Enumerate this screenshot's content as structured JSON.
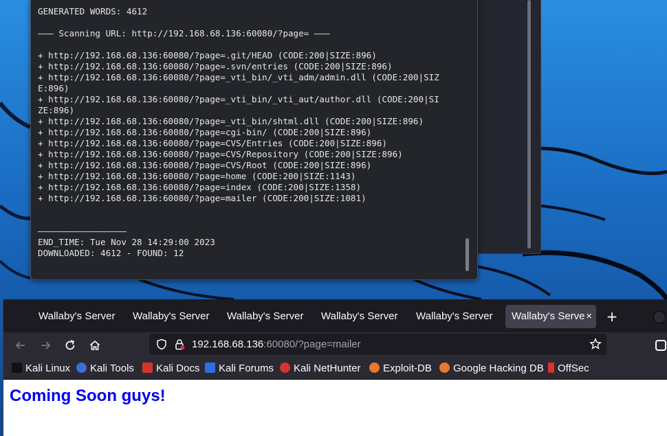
{
  "terminal": {
    "lines": [
      "GENERATED WORDS: 4612",
      "",
      "——— Scanning URL: http://192.168.68.136:60080/?page= ———",
      "",
      "+ http://192.168.68.136:60080/?page=.git/HEAD (CODE:200|SIZE:896)",
      "+ http://192.168.68.136:60080/?page=.svn/entries (CODE:200|SIZE:896)",
      "+ http://192.168.68.136:60080/?page=_vti_bin/_vti_adm/admin.dll (CODE:200|SIZ",
      "E:896)",
      "+ http://192.168.68.136:60080/?page=_vti_bin/_vti_aut/author.dll (CODE:200|SI",
      "ZE:896)",
      "+ http://192.168.68.136:60080/?page=_vti_bin/shtml.dll (CODE:200|SIZE:896)",
      "+ http://192.168.68.136:60080/?page=cgi-bin/ (CODE:200|SIZE:896)",
      "+ http://192.168.68.136:60080/?page=CVS/Entries (CODE:200|SIZE:896)",
      "+ http://192.168.68.136:60080/?page=CVS/Repository (CODE:200|SIZE:896)",
      "+ http://192.168.68.136:60080/?page=CVS/Root (CODE:200|SIZE:896)",
      "+ http://192.168.68.136:60080/?page=home (CODE:200|SIZE:1143)",
      "+ http://192.168.68.136:60080/?page=index (CODE:200|SIZE:1358)",
      "+ http://192.168.68.136:60080/?page=mailer (CODE:200|SIZE:1081)",
      "",
      "",
      "—————————————————",
      "END_TIME: Tue Nov 28 14:29:00 2023",
      "DOWNLOADED: 4612 - FOUND: 12"
    ]
  },
  "browser": {
    "tabs": [
      {
        "label": "Wallaby's Server"
      },
      {
        "label": "Wallaby's Server"
      },
      {
        "label": "Wallaby's Server"
      },
      {
        "label": "Wallaby's Server"
      },
      {
        "label": "Wallaby's Server"
      },
      {
        "label": "Wallaby's Server"
      }
    ],
    "close_glyph": "×",
    "new_tab_glyph": "+",
    "url": {
      "host": "192.168.68.136",
      "rest": ":60080/?page=mailer"
    },
    "bookmarks": [
      {
        "label": "Kali Linux",
        "icon": "kali-dragon-icon",
        "color": "#0b0b0b"
      },
      {
        "label": "Kali Tools",
        "icon": "kali-tools-icon",
        "color": "#3a6fd8"
      },
      {
        "label": "Kali Docs",
        "icon": "kali-docs-icon",
        "color": "#d9332b"
      },
      {
        "label": "Kali Forums",
        "icon": "kali-forums-icon",
        "color": "#2f6ee0"
      },
      {
        "label": "Kali NetHunter",
        "icon": "nethunter-icon",
        "color": "#d9332b"
      },
      {
        "label": "Exploit-DB",
        "icon": "exploit-db-icon",
        "color": "#e8792c"
      },
      {
        "label": "Google Hacking DB",
        "icon": "ghdb-icon",
        "color": "#e8792c"
      },
      {
        "label": "OffSec",
        "icon": "offsec-icon",
        "color": "#d9332b"
      }
    ]
  },
  "page": {
    "heading": "Coming Soon guys!"
  }
}
